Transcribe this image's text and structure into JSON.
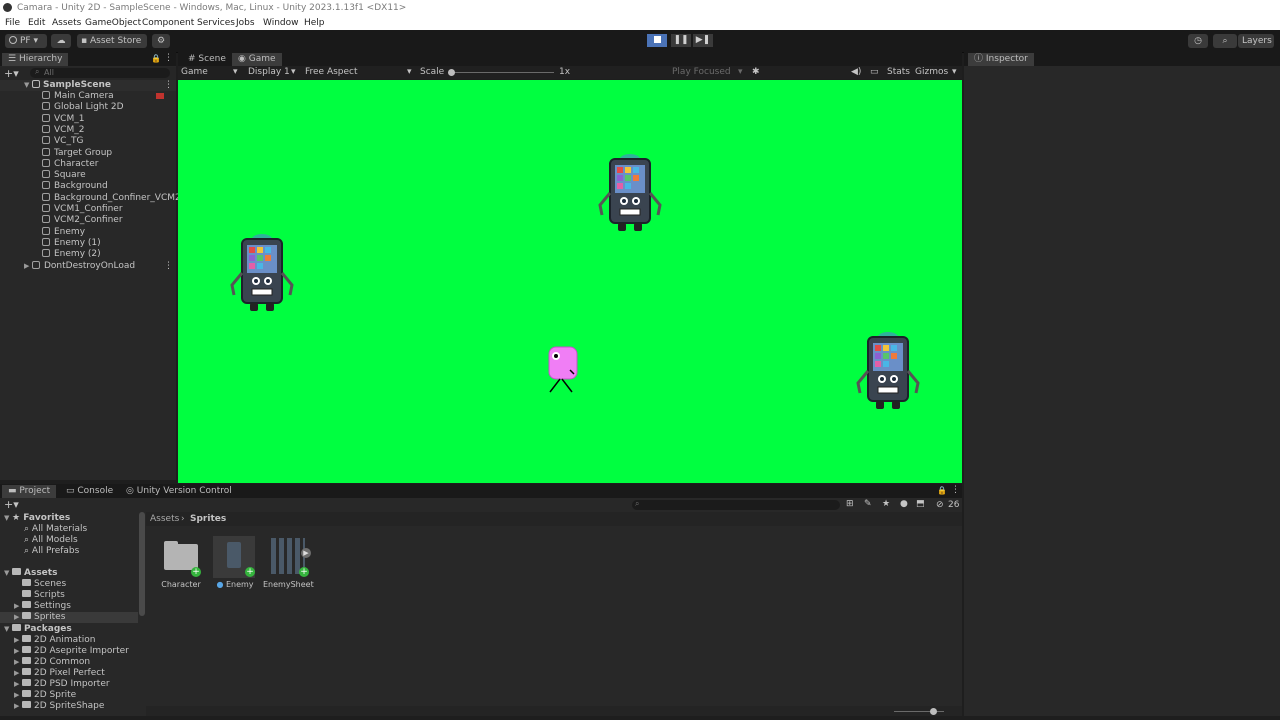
{
  "window": {
    "title": "Camara - Unity 2D - SampleScene - Windows, Mac, Linux - Unity 2023.1.13f1 <DX11>"
  },
  "menu": [
    "File",
    "Edit",
    "Assets",
    "GameObject",
    "Component",
    "Services",
    "Jobs",
    "Window",
    "Help"
  ],
  "toolbar": {
    "account": "PF ▾",
    "asset_store": "Asset Store ▾",
    "layers": "Layers"
  },
  "hierarchy": {
    "tab": "Hierarchy",
    "search_placeholder": "All",
    "scene": "SampleScene",
    "items": [
      "Main Camera",
      "Global Light 2D",
      "VCM_1",
      "VCM_2",
      "VC_TG",
      "Target Group",
      "Character",
      "Square",
      "Background",
      "Background_Confiner_VCM2",
      "VCM1_Confiner",
      "VCM2_Confiner",
      "Enemy",
      "Enemy (1)",
      "Enemy (2)"
    ],
    "dont_destroy": "DontDestroyOnLoad"
  },
  "tabs": {
    "scene": "Scene",
    "game": "Game",
    "inspector": "Inspector"
  },
  "game_toolbar": {
    "mode": "Game",
    "display": "Display 1",
    "aspect": "Free Aspect",
    "scale_label": "Scale",
    "scale_value": "1x",
    "play_mode": "Play Focused",
    "stats": "Stats",
    "gizmos": "Gizmos"
  },
  "game": {
    "background_color": "#00ff40"
  },
  "bottom_tabs": {
    "project": "Project",
    "console": "Console",
    "version": "Unity Version Control"
  },
  "project": {
    "favorites": {
      "label": "Favorites",
      "items": [
        "All Materials",
        "All Models",
        "All Prefabs"
      ]
    },
    "assets": {
      "label": "Assets",
      "items": [
        "Scenes",
        "Scripts",
        "Settings",
        "Sprites"
      ]
    },
    "packages": {
      "label": "Packages",
      "items": [
        "2D Animation",
        "2D Aseprite Importer",
        "2D Common",
        "2D Pixel Perfect",
        "2D PSD Importer",
        "2D Sprite",
        "2D SpriteShape"
      ]
    },
    "breadcrumb": [
      "Assets",
      "Sprites"
    ],
    "files": [
      "Character",
      "Enemy",
      "EnemySheet"
    ],
    "count": "26"
  },
  "icons": [
    "unity-logo-icon",
    "cloud-icon",
    "gear-icon",
    "play-icon",
    "pause-icon",
    "step-icon",
    "history-icon",
    "search-icon",
    "lock-icon",
    "menu-icon",
    "plus-icon",
    "folder-icon",
    "eye-icon"
  ]
}
